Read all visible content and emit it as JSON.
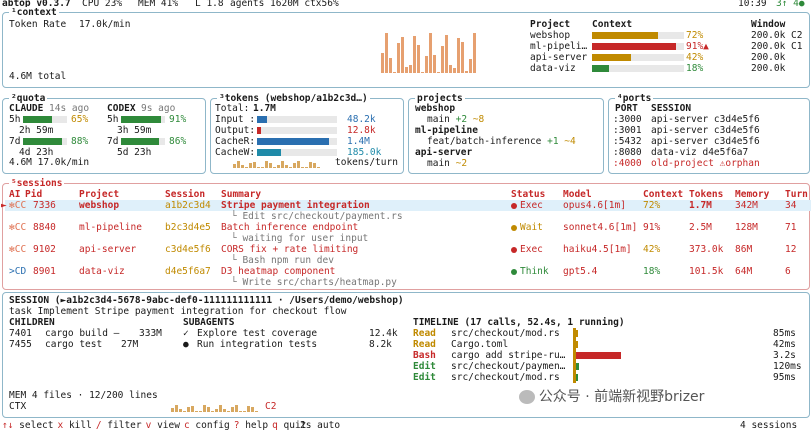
{
  "topbar": {
    "app": "abtop v0.3.7",
    "cpu": "CPU 23%",
    "mem": "MEM 41%",
    "load": "L 1.8",
    "agents": "agents 1620M ctx56%",
    "clock": "10:39",
    "indicators": "3↑ 4●"
  },
  "context": {
    "title": "¹context",
    "token_rate_label": "Token Rate",
    "token_rate_value": "17.0k/min",
    "total": "4.6M total",
    "headers": {
      "project": "Project",
      "context": "Context",
      "window": "Window"
    },
    "rows": [
      {
        "project": "webshop",
        "pct": "72%",
        "fill": 0.72,
        "color": "#c08a00",
        "window": "200.0k C2"
      },
      {
        "project": "ml-pipeli…",
        "pct": "91%▲",
        "fill": 0.91,
        "color": "#c62828",
        "window": "200.0k C1"
      },
      {
        "project": "api-server",
        "pct": "42%",
        "fill": 0.42,
        "color": "#c08a00",
        "window": "200.0k"
      },
      {
        "project": "data-viz",
        "pct": "18%",
        "fill": 0.18,
        "color": "#2f8a3a",
        "window": "200.0k"
      }
    ]
  },
  "quota": {
    "title": "²quota",
    "claude": {
      "label": "CLAUDE",
      "ago": "14s ago",
      "h5": "5h",
      "h5_pct": "65%",
      "h5_fill": 0.65,
      "h5_reset": "2h 59m",
      "d7": "7d",
      "d7_pct": "88%",
      "d7_fill": 0.88,
      "d7_reset": "4d 23h"
    },
    "codex": {
      "label": "CODEX",
      "ago": "9s ago",
      "h5": "5h",
      "h5_pct": "91%",
      "h5_fill": 0.91,
      "h5_reset": "3h 59m",
      "d7": "7d",
      "d7_pct": "86%",
      "d7_fill": 0.86,
      "d7_reset": "5d 23h"
    },
    "footer": "4.6M 17.0k/min"
  },
  "tokens": {
    "title": "³tokens (webshop/a1b2c3d…)",
    "total_label": "Total:",
    "total_value": "1.7M",
    "rows": [
      {
        "label": "Input :",
        "value": "48.2k",
        "color": "#2a6fb0",
        "fill": 0.12
      },
      {
        "label": "Output:",
        "value": "12.8k",
        "color": "#c62828",
        "fill": 0.05
      },
      {
        "label": "CacheR:",
        "value": "1.4M",
        "color": "#2a6fb0",
        "fill": 0.9
      },
      {
        "label": "CacheW:",
        "value": "185.0k",
        "color": "#1f8aa8",
        "fill": 0.3
      }
    ],
    "per_turn": "tokens/turn"
  },
  "projects": {
    "title": "projects",
    "items": [
      {
        "name": "webshop",
        "branch": "main",
        "add": "+2",
        "mod": "~8"
      },
      {
        "name": "ml-pipeline",
        "branch": "feat/batch-inference",
        "add": "+1",
        "mod": "~4"
      },
      {
        "name": "api-server",
        "branch": "main",
        "add": "",
        "mod": "~2"
      }
    ]
  },
  "ports": {
    "title": "⁴ports",
    "headers": {
      "port": "PORT",
      "session": "SESSION"
    },
    "rows": [
      {
        "port": ":3000",
        "session": "api-server c3d4e5f6"
      },
      {
        "port": ":3001",
        "session": "api-server c3d4e5f6"
      },
      {
        "port": ":5432",
        "session": "api-server c3d4e5f6"
      },
      {
        "port": ":8080",
        "session": "data-viz d4e5f6a7"
      },
      {
        "port": ":4000",
        "session": "old-project ⚠orphan"
      }
    ]
  },
  "sessions": {
    "title": "⁵sessions",
    "headers": {
      "ai": "AI",
      "pid": "Pid",
      "project": "Project",
      "session": "Session",
      "summary": "Summary",
      "status": "Status",
      "model": "Model",
      "context": "Context",
      "tokens": "Tokens",
      "memory": "Memory",
      "turn": "Turn"
    },
    "rows": [
      {
        "marker": "►",
        "ai": "✻CC",
        "pid": "7336",
        "project": "webshop",
        "session": "a1b2c3d4",
        "summary": "Stripe payment integration",
        "sub": "└ Edit src/checkout/payment.rs",
        "status": "Exec",
        "status_color": "#c62828",
        "model": "opus4.6[1m]",
        "ctx": "72%",
        "ctx_color": "#c08a00",
        "tokens": "1.7M",
        "memory": "342M",
        "turn": "34"
      },
      {
        "marker": "",
        "ai": "✻CC",
        "pid": "8840",
        "project": "ml-pipeline",
        "session": "b2c3d4e5",
        "summary": "Batch inference endpoint",
        "sub": "└ waiting for user input",
        "status": "Wait",
        "status_color": "#c08a00",
        "model": "sonnet4.6[1m]",
        "ctx": "91%",
        "ctx_color": "#c62828",
        "tokens": "2.5M",
        "memory": "128M",
        "turn": "71"
      },
      {
        "marker": "",
        "ai": "✻CC",
        "pid": "9102",
        "project": "api-server",
        "session": "c3d4e5f6",
        "summary": "CORS fix + rate limiting",
        "sub": "└ Bash npm run dev",
        "status": "Exec",
        "status_color": "#c62828",
        "model": "haiku4.5[1m]",
        "ctx": "42%",
        "ctx_color": "#c08a00",
        "tokens": "373.0k",
        "memory": "86M",
        "turn": "12"
      },
      {
        "marker": "",
        "ai": ">CD",
        "pid": "8901",
        "project": "data-viz",
        "session": "d4e5f6a7",
        "summary": "D3 heatmap component",
        "sub": "└ Write src/charts/heatmap.py",
        "status": "Think",
        "status_color": "#2f8a3a",
        "model": "gpt5.4",
        "ctx": "18%",
        "ctx_color": "#2f8a3a",
        "tokens": "101.5k",
        "memory": "64M",
        "turn": "6"
      }
    ]
  },
  "detail": {
    "session_line": "SESSION (►a1b2c3d4-5678-9abc-def0-111111111111 · /Users/demo/webshop)",
    "task": "task Implement Stripe payment integration for checkout flow",
    "children_title": "CHILDREN",
    "children": [
      {
        "pid": "7401",
        "cmd": "cargo build —",
        "mem": "333M"
      },
      {
        "pid": "7455",
        "cmd": "cargo test",
        "mem": "27M"
      }
    ],
    "subagents_title": "SUBAGENTS",
    "subagents": [
      {
        "mark": "✓",
        "label": "Explore test coverage",
        "tokens": "12.4k"
      },
      {
        "mark": "●",
        "label": "Run integration tests",
        "tokens": "8.2k"
      }
    ],
    "timeline_title": "TIMELINE (17 calls, 52.4s, 1 running)",
    "timeline": [
      {
        "tool": "Read",
        "color": "#c08a00",
        "target": "src/checkout/mod.rs",
        "dur": "85ms",
        "fill": 0.02
      },
      {
        "tool": "Read",
        "color": "#c08a00",
        "target": "Cargo.toml",
        "dur": "42ms",
        "fill": 0.01
      },
      {
        "tool": "Bash",
        "color": "#c62828",
        "target": "cargo add stripe-ru…",
        "dur": "3.2s",
        "fill": 0.5
      },
      {
        "tool": "Edit",
        "color": "#2f8a3a",
        "target": "src/checkout/paymen…",
        "dur": "120ms",
        "fill": 0.03
      },
      {
        "tool": "Edit",
        "color": "#2f8a3a",
        "target": "src/checkout/mod.rs",
        "dur": "95ms",
        "fill": 0.02
      }
    ],
    "mem": "MEM 4 files · 12/200 lines",
    "ctx": "CTX",
    "ctx_badge": "C2"
  },
  "watermark": "公众号 · 前端新视野brizer",
  "footer": {
    "keys": [
      {
        "k": "↑↓",
        "v": "select"
      },
      {
        "k": "x",
        "v": "kill"
      },
      {
        "k": "/",
        "v": "filter"
      },
      {
        "k": "v",
        "v": "view"
      },
      {
        "k": "c",
        "v": "config"
      },
      {
        "k": "?",
        "v": "help"
      },
      {
        "k": "q",
        "v": "quit"
      }
    ],
    "auto": "2s auto",
    "sessions": "4 sessions"
  }
}
